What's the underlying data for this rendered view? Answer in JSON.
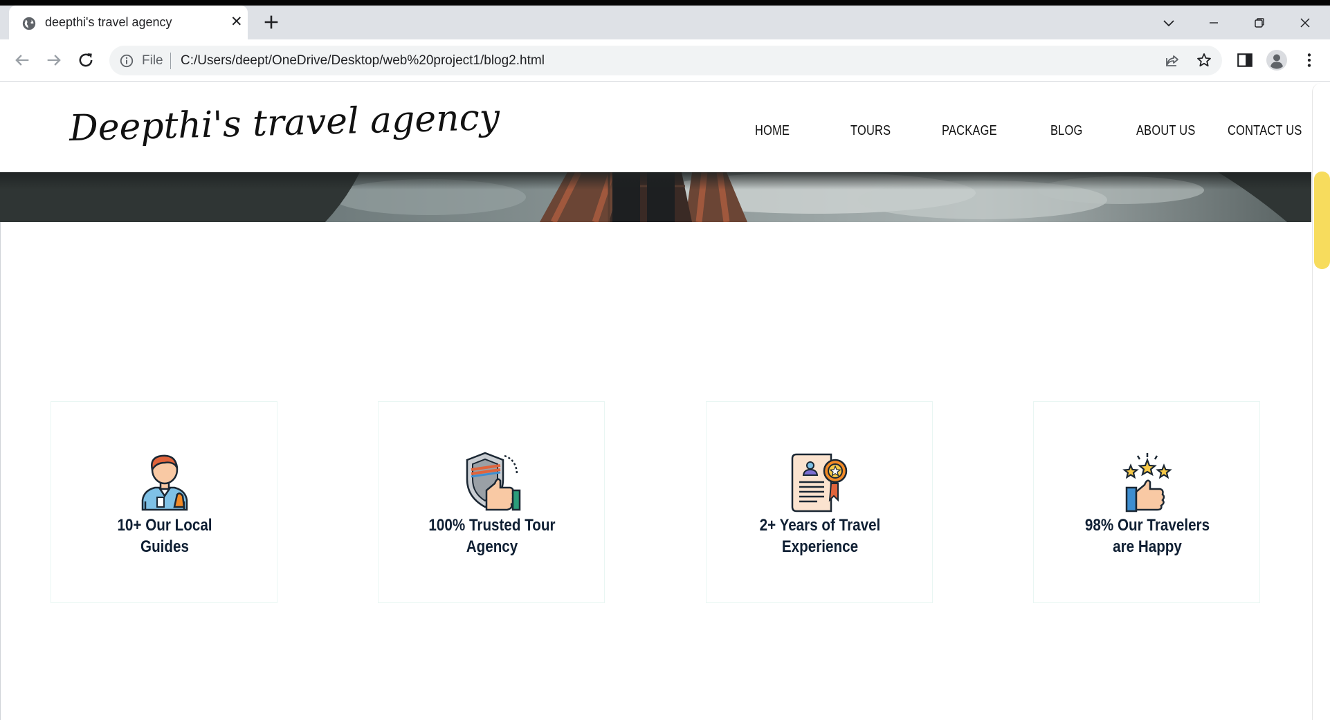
{
  "browser": {
    "tab_title": "deepthi's travel agency",
    "tab_close": "✕",
    "scheme_label": "File",
    "url": "C:/Users/deept/OneDrive/Desktop/web%20project1/blog2.html"
  },
  "site": {
    "logo": "Deepthi's travel agency",
    "nav": [
      "HOME",
      "TOURS",
      "PACKAGE",
      "BLOG",
      "ABOUT US",
      "CONTACT US"
    ]
  },
  "features": [
    {
      "label": "10+ Our Local Guides",
      "icon": "local-guide-icon"
    },
    {
      "label": "100% Trusted Tour Agency",
      "icon": "trusted-shield-icon"
    },
    {
      "label": "2+ Years of Travel Experience",
      "icon": "certificate-icon"
    },
    {
      "label": "98% Our Travelers are Happy",
      "icon": "happy-travelers-icon"
    }
  ],
  "colors": {
    "scroll_thumb": "#f7dc5d",
    "feature_text": "#0f1f33",
    "card_border": "#e9f6f3"
  }
}
